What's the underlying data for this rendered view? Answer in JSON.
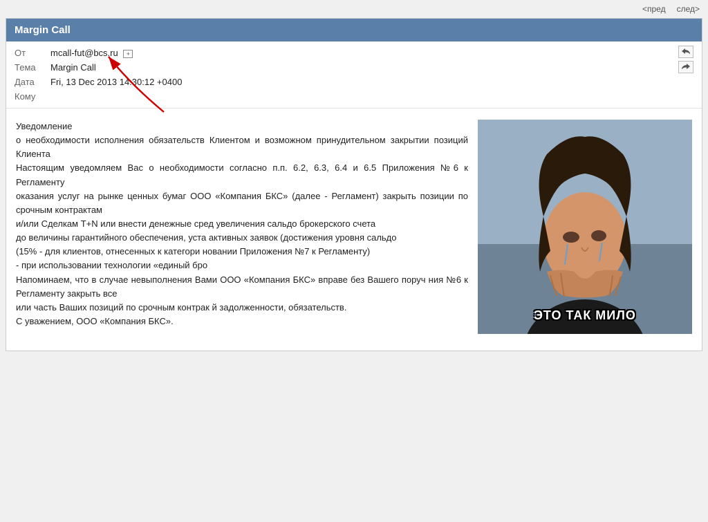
{
  "nav": {
    "prev_label": "<пред",
    "next_label": "след>"
  },
  "email": {
    "window_title": "Margin Call",
    "meta": {
      "from_label": "От",
      "from_value": "mcall-fut@bcs.ru",
      "from_icon": "+",
      "subject_label": "Тема",
      "subject_value": "Margin Call",
      "date_label": "Дата",
      "date_value": "Fri, 13 Dec 2013 14:30:12 +0400",
      "to_label": "Кому",
      "to_value": ""
    },
    "body": {
      "paragraph1": "Уведомление",
      "paragraph2": "о необходимости исполнения обязательств Клиентом и возможном принудительном закрытии позиций Клиента",
      "paragraph3": "Настоящим уведомляем Вас о необходимости согласно п.п. 6.2, 6.3, 6.4 и 6.5 Приложения №6 к Регламенту",
      "paragraph4": "оказания услуг на рынке ценных бумаг ООО «Компания БКС» (далее - Регламент) закрыть позиции по срочным контрактам",
      "paragraph5": "и/или Сделкам Т+N или внести денежные сред увеличения сальдо брокерского счета",
      "paragraph6": "до величины гарантийного обеспечения, уста активных заявок (достижения уровня сальдо",
      "paragraph7": "(15% - для клиентов, отнесенных к категори                                            новании Приложения №7 к Регламенту)",
      "paragraph8": "- при использовании технологии «единый бро",
      "paragraph9": "Напоминаем, что в случае невыполнения Вами ООО «Компания БКС» вправе без Вашего поруч                     ния №6 к Регламенту закрыть все",
      "paragraph10": "или часть Ваших позиций по срочным контрак                                                й задолженности, обязательств.",
      "paragraph11": "С уважением, ООО «Компания БКС».",
      "meme_caption": "ЭТО ТАК МИЛО"
    }
  }
}
